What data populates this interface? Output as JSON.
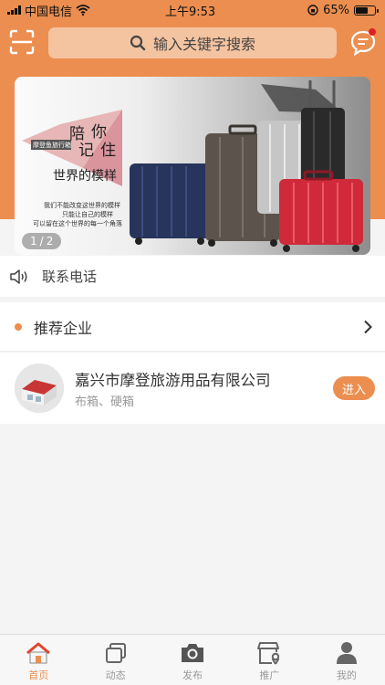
{
  "status_bar": {
    "carrier": "中国电信",
    "time": "上午9:53",
    "battery": "65%"
  },
  "search": {
    "placeholder": "输入关键字搜索"
  },
  "banner": {
    "slogan_1": "陪",
    "slogan_2": "你",
    "slogan_3": "记",
    "slogan_4": "住",
    "slogan_5": "世界的模样",
    "tag": "摩登鱼旅行箱",
    "caption": [
      "我们不能改变这世界的模样",
      "只能让自己的模样",
      "可以留在这个世界的每一个角落"
    ],
    "indicator_current": "1",
    "indicator_sep": "/",
    "indicator_total": "2"
  },
  "contact": {
    "label": "联系电话"
  },
  "recommend": {
    "title": "推荐企业"
  },
  "company": {
    "name": "嘉兴市摩登旅游用品有限公司",
    "tags": "布箱、硬箱",
    "enter_label": "进入"
  },
  "tabs": [
    {
      "label": "首页",
      "icon": "home-icon",
      "active": true
    },
    {
      "label": "动态",
      "icon": "stack-icon",
      "active": false
    },
    {
      "label": "发布",
      "icon": "camera-icon",
      "active": false
    },
    {
      "label": "推广",
      "icon": "store-icon",
      "active": false
    },
    {
      "label": "我的",
      "icon": "person-icon",
      "active": false
    }
  ],
  "colors": {
    "accent": "#ec8e4f",
    "search_bg": "#f4c3a0",
    "page_bg": "#f4f4f4",
    "badge": "#e02020"
  }
}
